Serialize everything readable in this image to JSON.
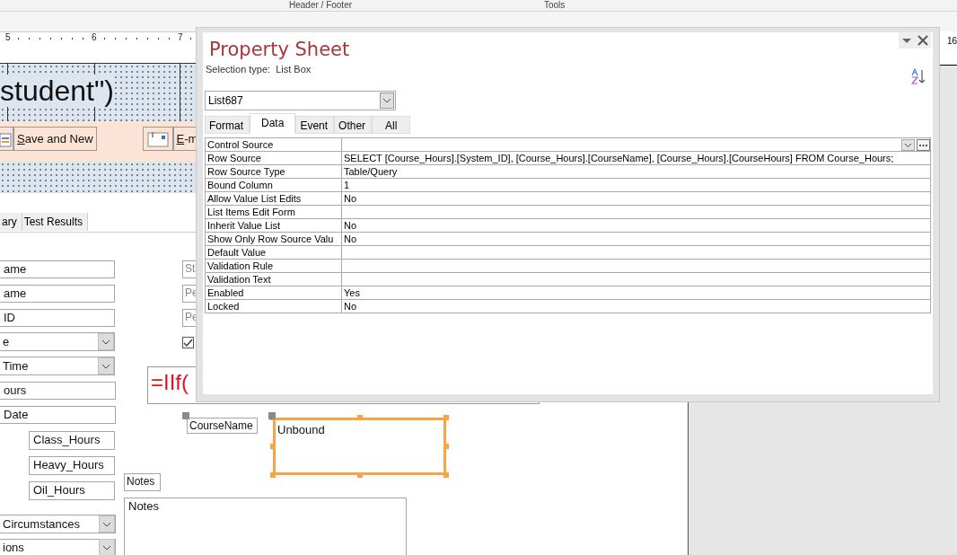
{
  "ribbon": {
    "groups": [
      "Header / Footer",
      "Tools"
    ]
  },
  "ruler": {
    "marks": [
      "5",
      "6",
      "7"
    ],
    "right_marks": [
      "16"
    ]
  },
  "form": {
    "title_text": "student\")",
    "buttons": [
      {
        "label": "Save and New",
        "kind": "save"
      },
      {
        "label": "E-m",
        "kind": "email"
      }
    ],
    "tabs": [
      {
        "label": "ary",
        "selected": false
      },
      {
        "label": "Test Results",
        "selected": false
      }
    ],
    "controls": [
      {
        "kind": "textbox",
        "value": "ame",
        "selected": false
      },
      {
        "kind": "textbox",
        "value": "ame",
        "selected": false
      },
      {
        "kind": "textbox",
        "value": "ID",
        "selected": false
      },
      {
        "kind": "combo",
        "value": "e",
        "selected": false
      },
      {
        "kind": "combo",
        "value": "Time",
        "selected": false
      },
      {
        "kind": "textbox",
        "value": "ours",
        "selected": false
      },
      {
        "kind": "textbox",
        "value": "Date",
        "selected": false
      },
      {
        "kind": "textbox",
        "value": "Class_Hours",
        "selected": false
      },
      {
        "kind": "textbox",
        "value": "Heavy_Hours",
        "selected": false
      },
      {
        "kind": "textbox",
        "value": "Oil_Hours",
        "selected": false
      },
      {
        "kind": "combo",
        "value": "Circumstances",
        "selected": false
      },
      {
        "kind": "combo",
        "value": "ions",
        "selected": false
      },
      {
        "kind": "label",
        "value": "St",
        "selected": false
      },
      {
        "kind": "label",
        "value": "Pe",
        "selected": false
      },
      {
        "kind": "label",
        "value": "Pe",
        "selected": false
      },
      {
        "kind": "checkbox",
        "checked": true
      },
      {
        "kind": "expression",
        "value": "=IIf(",
        "selected": false
      },
      {
        "kind": "label",
        "value": "CourseName",
        "selected": false,
        "move_handle": true
      },
      {
        "kind": "listbox",
        "value": "Unbound",
        "selected": true
      },
      {
        "kind": "label",
        "value": "Notes",
        "selected": false
      },
      {
        "kind": "textbox",
        "value": "Notes",
        "selected": false
      }
    ]
  },
  "property_sheet": {
    "title": "Property Sheet",
    "selection_type_label": "Selection type:",
    "selection_type": "List Box",
    "object": "List687",
    "tabs": [
      {
        "label": "Format",
        "selected": false
      },
      {
        "label": "Data",
        "selected": true
      },
      {
        "label": "Event",
        "selected": false
      },
      {
        "label": "Other",
        "selected": false
      },
      {
        "label": "All",
        "selected": false
      }
    ],
    "properties": [
      {
        "name": "Control Source",
        "selected": true
      },
      {
        "name": "Row Source",
        "value": "SELECT [Course_Hours].[System_ID], [Course_Hours].[CourseName], [Course_Hours].[CourseHours] FROM Course_Hours;",
        "selected": false
      },
      {
        "name": "Row Source Type",
        "value": "Table/Query",
        "selected": false
      },
      {
        "name": "Bound Column",
        "value": "1",
        "selected": false
      },
      {
        "name": "Allow Value List Edits",
        "value": "No",
        "selected": false
      },
      {
        "name": "List Items Edit Form",
        "selected": false
      },
      {
        "name": "Inherit Value List",
        "value": "No",
        "selected": false
      },
      {
        "name": "Show Only Row Source Valu",
        "value": "No",
        "selected": false
      },
      {
        "name": "Default Value",
        "selected": false
      },
      {
        "name": "Validation Rule",
        "selected": false
      },
      {
        "name": "Validation Text",
        "selected": false
      },
      {
        "name": "Enabled",
        "value": "Yes",
        "selected": false
      },
      {
        "name": "Locked",
        "value": "No",
        "selected": false
      }
    ]
  }
}
